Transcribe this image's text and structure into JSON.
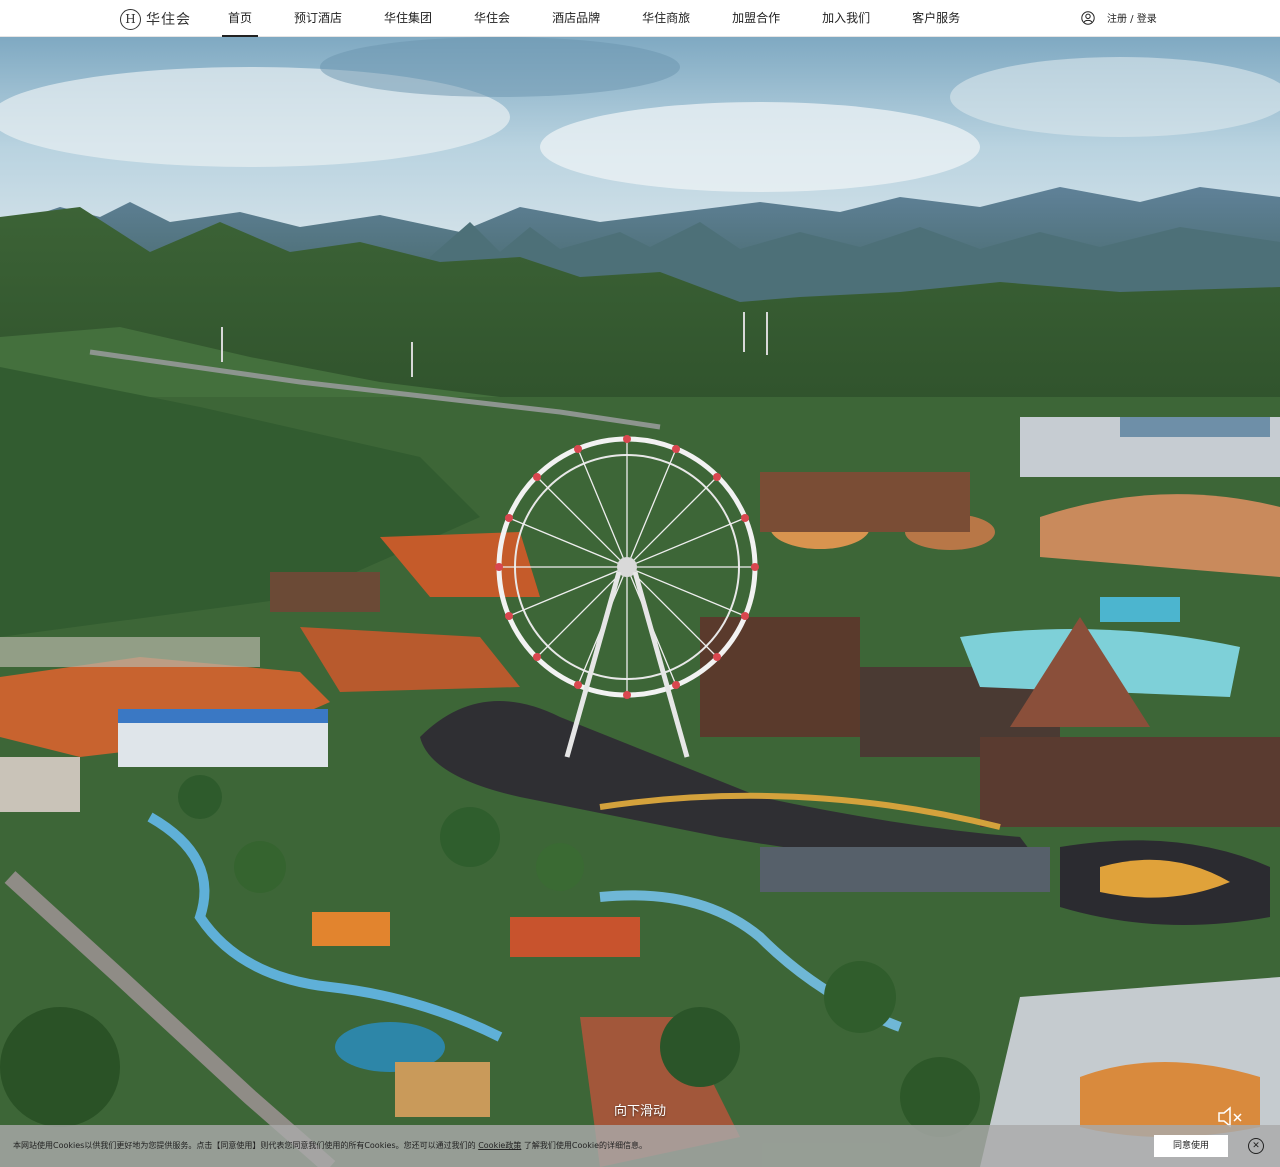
{
  "header": {
    "logo_mark": "H",
    "logo_text": "华住会",
    "nav": [
      {
        "label": "首页",
        "active": true
      },
      {
        "label": "预订酒店"
      },
      {
        "label": "华住集团"
      },
      {
        "label": "华住会"
      },
      {
        "label": "酒店品牌"
      },
      {
        "label": "华住商旅"
      },
      {
        "label": "加盟合作"
      },
      {
        "label": "加入我们"
      },
      {
        "label": "客户服务"
      }
    ],
    "auth_label": "注册 / 登录",
    "user_icon": "user-icon"
  },
  "hero": {
    "scroll_hint": "向下滑动",
    "mute_icon": "speaker-muted-icon"
  },
  "cookie": {
    "text_before": "本网站使用Cookies以供我们更好地为您提供服务。点击【同意使用】则代表您同意我们使用的所有Cookies。您还可以通过我们的 ",
    "link_label": "Cookie政策",
    "text_after": " 了解我们使用Cookie的详细信息。",
    "agree_label": "同意使用",
    "close_icon": "close-icon"
  },
  "colors": {
    "sky": "#9fc3d6",
    "forest": "#3f6a3a",
    "soil": "#c9622f",
    "water": "#3fa8c2"
  }
}
